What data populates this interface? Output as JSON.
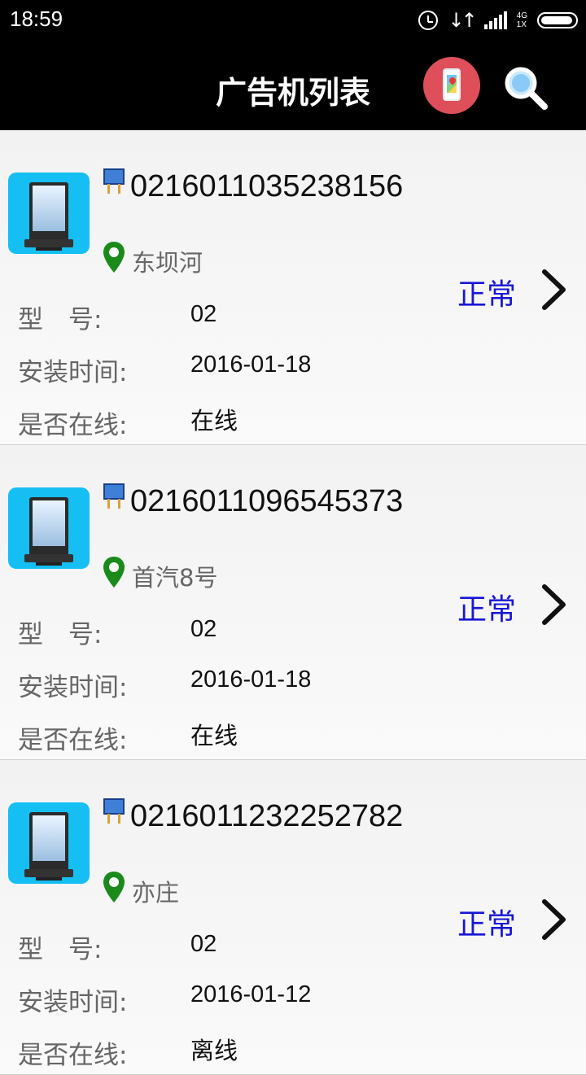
{
  "status_bar": {
    "time": "18:59",
    "network": "4G",
    "network_sub": "1X",
    "icons": [
      "alarm-icon",
      "data-transfer-icon",
      "signal-icon",
      "battery-icon"
    ]
  },
  "header": {
    "title": "广告机列表",
    "map_button_icon": "phone-map-icon",
    "search_icon": "search-icon"
  },
  "labels": {
    "model": "型　号:",
    "install_time": "安装时间:",
    "online": "是否在线:"
  },
  "devices": [
    {
      "code": "0216011035238156",
      "location": "东坝河",
      "status": "正常",
      "model": "02",
      "install_time": "2016-01-18",
      "online": "在线"
    },
    {
      "code": "0216011096545373",
      "location": "首汽8号",
      "status": "正常",
      "model": "02",
      "install_time": "2016-01-18",
      "online": "在线"
    },
    {
      "code": "0216011232252782",
      "location": "亦庄",
      "status": "正常",
      "model": "02",
      "install_time": "2016-01-12",
      "online": "离线"
    }
  ],
  "colors": {
    "status_blue": "#1717d6",
    "thumb_blue": "#15bff3",
    "map_button": "#de4f5a",
    "pin_green": "#1a8a1a"
  }
}
